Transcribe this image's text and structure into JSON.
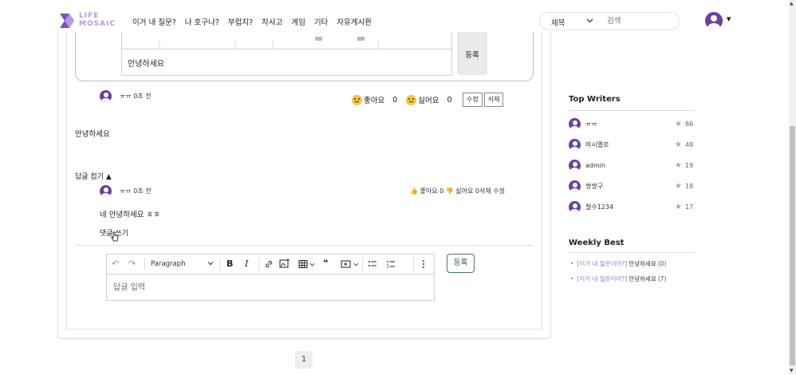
{
  "header": {
    "logo_line1": "LIFE",
    "logo_line2": "MOSAIC",
    "nav": [
      "이거 내 질문?",
      "나 호구냐?",
      "부럽지?",
      "차사고",
      "게임",
      "기타",
      "자유게시판"
    ],
    "search_select": "제목",
    "search_placeholder": "검색"
  },
  "top_comment_box": {
    "editor_text": "안녕하세요",
    "submit_label": "등록"
  },
  "comment": {
    "author": "ㅠㅠ",
    "time": "0초 전",
    "like_label": "좋아요",
    "like_count": "0",
    "dislike_label": "싫어요",
    "dislike_count": "0",
    "edit_label": "수정",
    "delete_label": "삭제",
    "body": "안녕하세요",
    "fold_label": "답글 접기 ▲"
  },
  "reply": {
    "author": "ㅠㅠ",
    "time": "0초 전",
    "reactions_text": "👍 좋아요 0 👎 싫어요 0삭제 수정",
    "body": "네 안녕하세요 ㅎㅎ",
    "write_label": "댓글 쓰기"
  },
  "editor": {
    "paragraph_label": "Paragraph",
    "placeholder": "답글 입력",
    "submit_label": "등록"
  },
  "pagination": {
    "current": "1"
  },
  "sidebar": {
    "top_writers_title": "Top Writers",
    "writers": [
      {
        "name": "ㅠㅠ",
        "points": "86"
      },
      {
        "name": "마시멜로",
        "points": "48"
      },
      {
        "name": "admin",
        "points": "19"
      },
      {
        "name": "쌍쌍구",
        "points": "18"
      },
      {
        "name": "철수1234",
        "points": "17"
      }
    ],
    "weekly_best_title": "Weekly Best",
    "weekly_best": [
      {
        "tag": "[이거 내 질문이야?]",
        "title": "안녕하세요",
        "count": "(0)"
      },
      {
        "tag": "[이거 내 질문이야?]",
        "title": "안녕하세요",
        "count": "(7)"
      }
    ]
  },
  "colors": {
    "brand": "#6d3fa0",
    "accent_light": "#b497d6",
    "button_green": "#4a7a5a"
  }
}
